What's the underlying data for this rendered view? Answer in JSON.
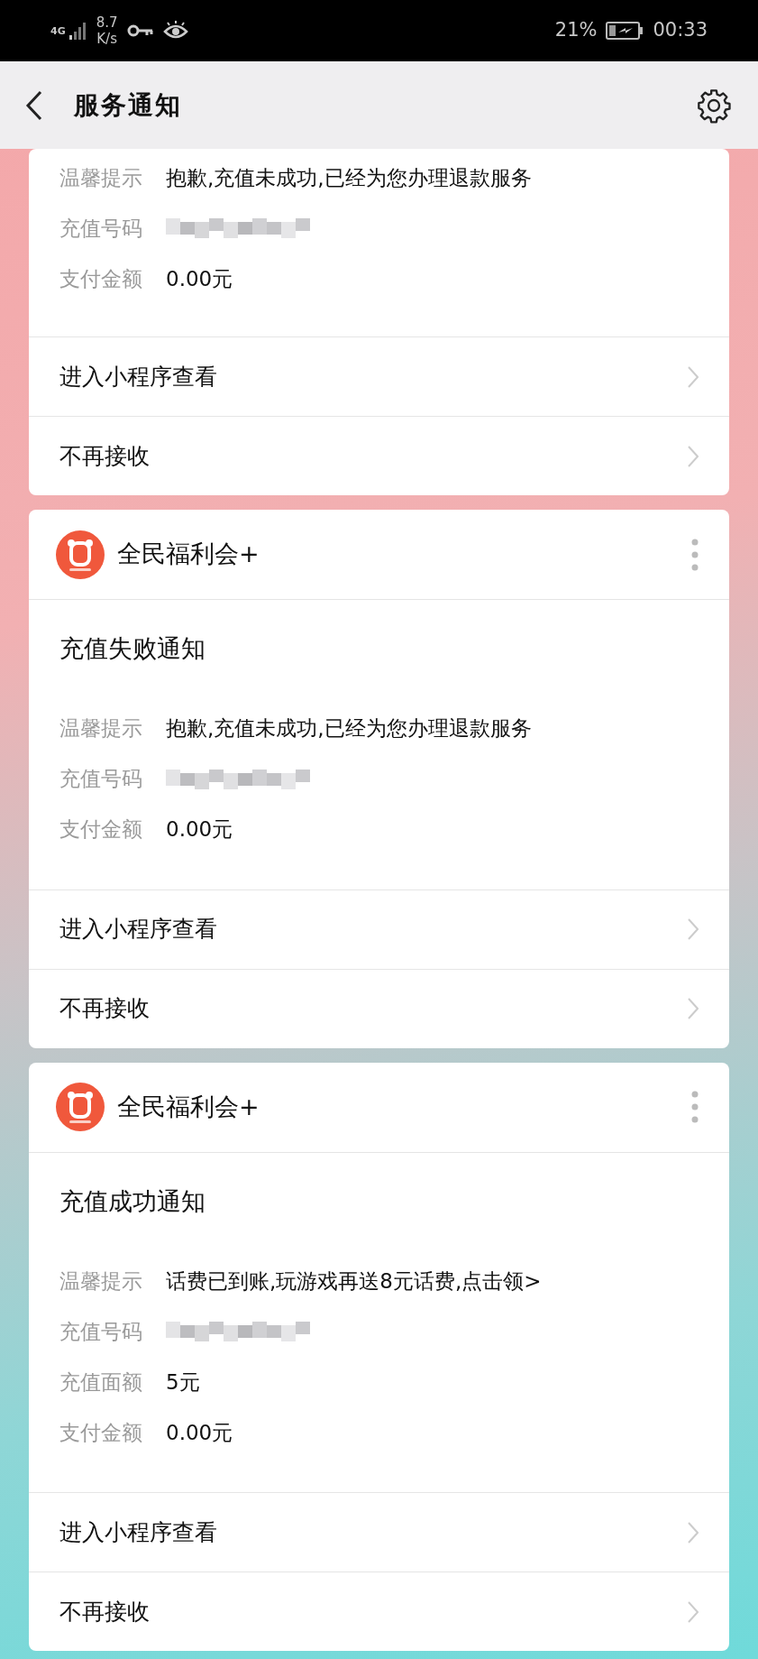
{
  "status_bar": {
    "network": "4G",
    "speed": "8.7",
    "speed_unit": "K/s",
    "battery": "21%",
    "time": "00:33"
  },
  "header": {
    "title": "服务通知"
  },
  "cards": [
    {
      "fields": [
        {
          "label": "温馨提示",
          "kind": "text",
          "value": "抱歉,充值未成功,已经为您办理退款服务"
        },
        {
          "label": "充值号码",
          "kind": "redacted"
        },
        {
          "label": "支付金额",
          "kind": "text",
          "value": "0.00元"
        }
      ],
      "actions": [
        "进入小程序查看",
        "不再接收"
      ]
    },
    {
      "app": "全民福利会+",
      "title": "充值失败通知",
      "fields": [
        {
          "label": "温馨提示",
          "kind": "text",
          "value": "抱歉,充值未成功,已经为您办理退款服务"
        },
        {
          "label": "充值号码",
          "kind": "redacted"
        },
        {
          "label": "支付金额",
          "kind": "text",
          "value": "0.00元"
        }
      ],
      "actions": [
        "进入小程序查看",
        "不再接收"
      ]
    },
    {
      "app": "全民福利会+",
      "title": "充值成功通知",
      "fields": [
        {
          "label": "温馨提示",
          "kind": "text",
          "value": "话费已到账,玩游戏再送8元话费,点击领>"
        },
        {
          "label": "充值号码",
          "kind": "redacted"
        },
        {
          "label": "充值面额",
          "kind": "text",
          "value": "5元"
        },
        {
          "label": "支付金额",
          "kind": "text",
          "value": "0.00元"
        }
      ],
      "actions": [
        "进入小程序查看",
        "不再接收"
      ]
    }
  ]
}
